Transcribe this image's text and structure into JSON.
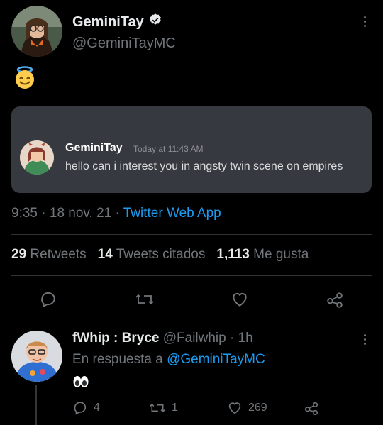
{
  "tweet": {
    "author_name": "GeminiTay",
    "author_handle": "@GeminiTayMC",
    "verified": true,
    "emoji": "smiling-face-with-halo",
    "embed": {
      "name": "GeminiTay",
      "time": "Today at 11:43 AM",
      "message": "hello can i interest you in angsty twin scene on empires"
    },
    "time": "9:35",
    "date": "18 nov. 21",
    "source": "Twitter Web App",
    "stats": {
      "retweets_count": "29",
      "retweets_label": "Retweets",
      "quotes_count": "14",
      "quotes_label": "Tweets citados",
      "likes_count": "1,113",
      "likes_label": "Me gusta"
    }
  },
  "reply": {
    "author_name": "fWhip : Bryce",
    "author_handle": "@Failwhip",
    "time": "1h",
    "in_reply_prefix": "En respuesta a",
    "in_reply_to": "@GeminiTayMC",
    "emoji": "eyes",
    "replies": "4",
    "retweets": "1",
    "likes": "269"
  },
  "colors": {
    "background": "#000000",
    "link": "#1d9bf0",
    "muted": "#71767b",
    "discord_card": "#36393f"
  }
}
